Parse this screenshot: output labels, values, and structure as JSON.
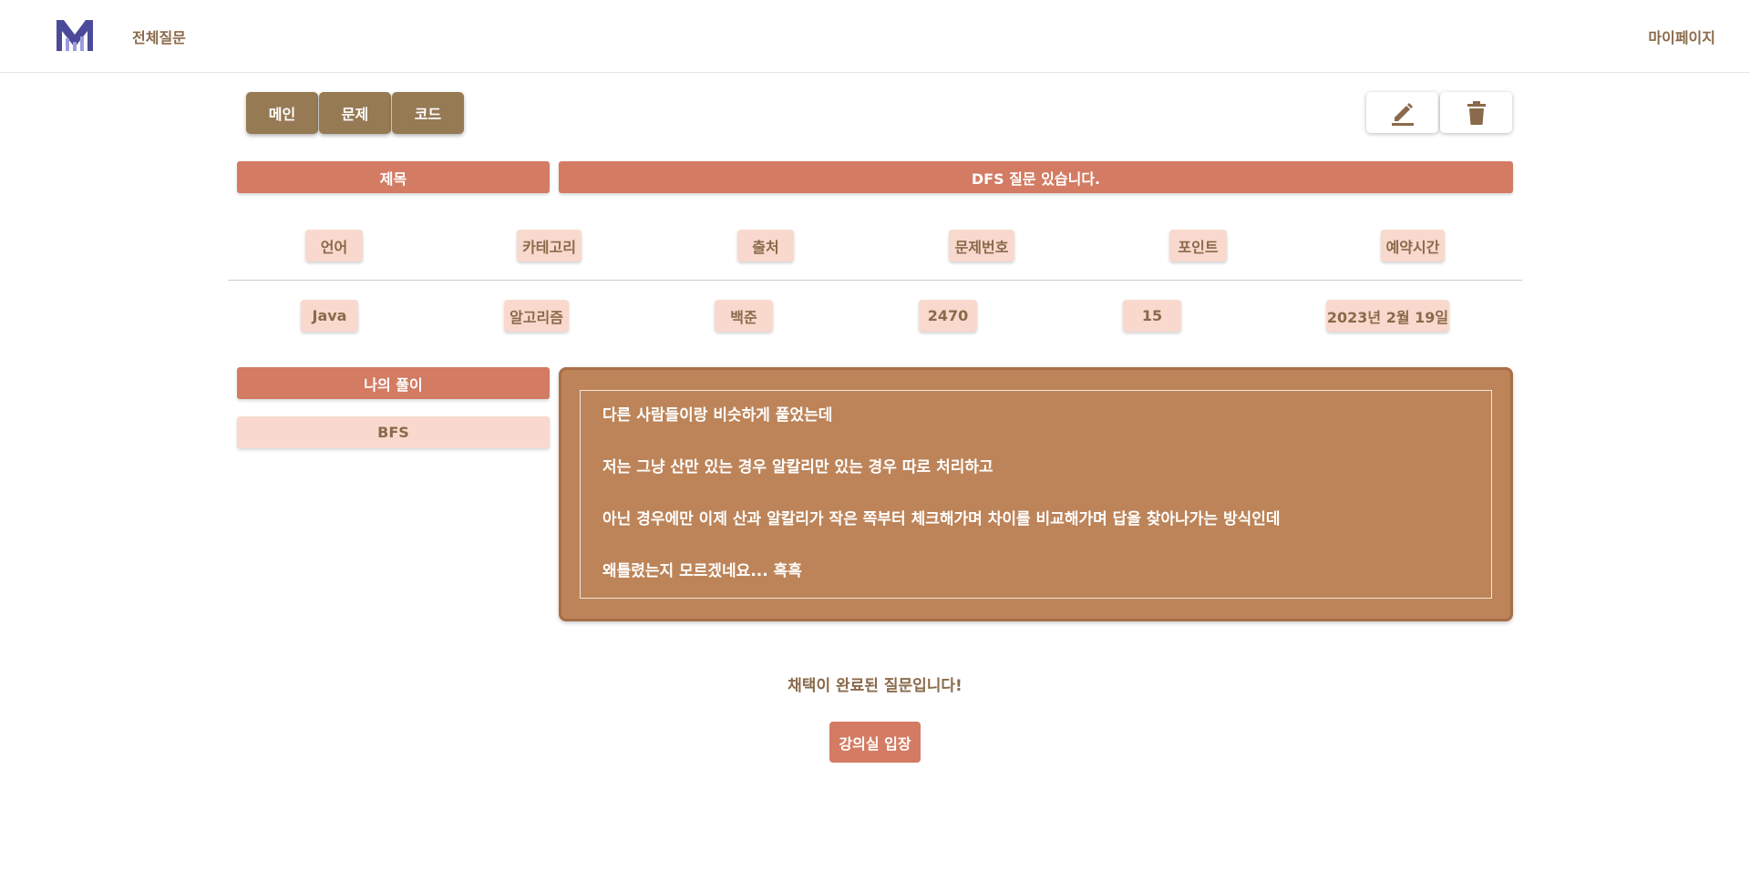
{
  "nav": {
    "all_questions": "전체질문",
    "my_page": "마이페이지"
  },
  "tabs": [
    "메인",
    "문제",
    "코드"
  ],
  "actions": {
    "edit_icon": "pencil-icon",
    "delete_icon": "trash-icon"
  },
  "question": {
    "title_label": "제목",
    "title": "DFS 질문 있습니다."
  },
  "info": {
    "headers": [
      "언어",
      "카테고리",
      "출처",
      "문제번호",
      "포인트",
      "예약시간"
    ],
    "values": [
      "Java",
      "알고리즘",
      "백준",
      "2470",
      "15",
      "2023년 2월 19일"
    ]
  },
  "solution": {
    "label": "나의 풀이",
    "tag": "BFS"
  },
  "content": [
    "다른 사람들이랑 비슷하게 풀었는데",
    "저는 그냥 산만 있는 경우 알칼리만 있는 경우 따로 처리하고",
    "아닌 경우에만 이제 산과 알칼리가 작은 쪽부터 체크해가며 차이를 비교해가며 답을 찾아나가는 방식인데",
    "왜틀렸는지 모르겠네요...  흑흑"
  ],
  "notice": "채택이 완료된 질문입니다!",
  "enter_button": "강의실 입장",
  "colors": {
    "brown": "#967a54",
    "coral": "#d37b63",
    "peach": "#f9d9cd",
    "content_bg": "#bd8459",
    "text": "#8a6a4a"
  }
}
